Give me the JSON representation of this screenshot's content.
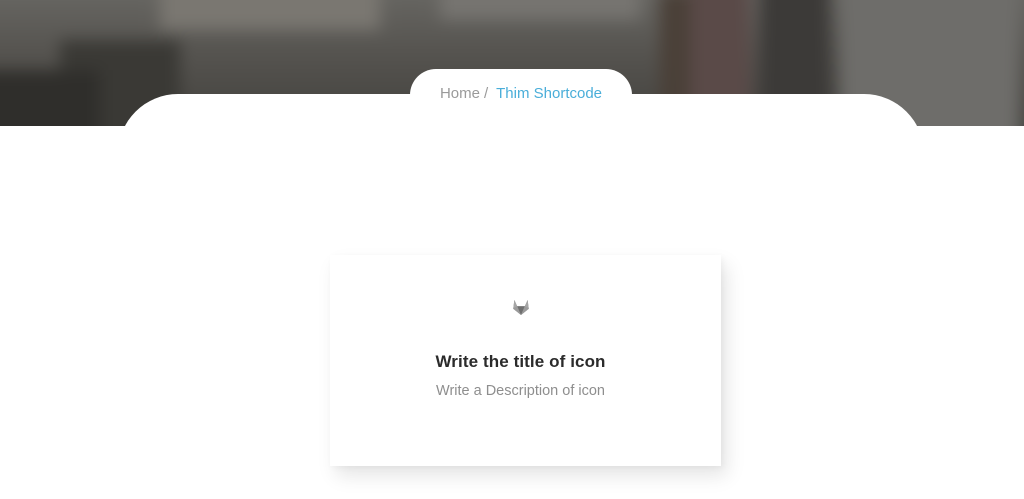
{
  "breadcrumb": {
    "home_label": "Home",
    "separator": "/",
    "current_label": "Thim Shortcode"
  },
  "icon_box": {
    "icon": "gitlab-fox-icon",
    "title": "Write the title of icon",
    "description": "Write a Description of icon"
  },
  "colors": {
    "accent": "#4aaed9",
    "title_text": "#2b2b2b",
    "muted_text": "#9a9a9a",
    "hero_overlay": "#5d5d5b"
  }
}
